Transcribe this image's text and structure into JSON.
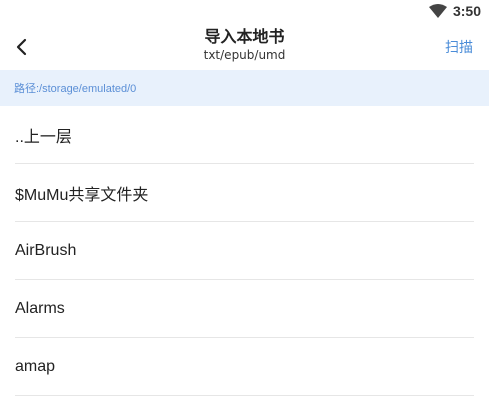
{
  "status_bar": {
    "time": "3:50",
    "wifi_icon": "wifi-icon"
  },
  "header": {
    "back_icon": "chevron-left-icon",
    "title": "导入本地书",
    "subtitle": "txt/epub/umd",
    "scan_label": "扫描"
  },
  "path": {
    "text": "路径:/storage/emulated/0"
  },
  "files": [
    {
      "label": "..上一层"
    },
    {
      "label": "$MuMu共享文件夹"
    },
    {
      "label": "AirBrush"
    },
    {
      "label": "Alarms"
    },
    {
      "label": "amap"
    }
  ],
  "colors": {
    "accent": "#4a8cd8",
    "path_bar_bg": "#e8f1fc"
  }
}
